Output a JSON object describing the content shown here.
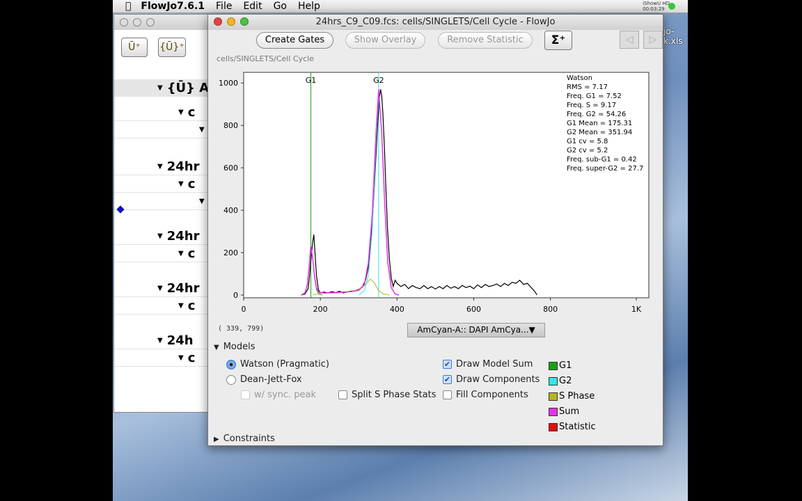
{
  "menubar": {
    "app": "FlowJo7.6.1",
    "items": [
      "File",
      "Edit",
      "Go",
      "Help"
    ],
    "status_app": "iShowU HD",
    "status_time": "00:03:29"
  },
  "desktop": {
    "file_label": "jo-\nk.xls"
  },
  "workspace": {
    "rows": [
      {
        "label": "{Ū} All",
        "indent": 1
      },
      {
        "label": "c",
        "indent": 2
      },
      {
        "label": "",
        "indent": 3
      },
      {
        "label": "24hr",
        "indent": 1
      },
      {
        "label": "c",
        "indent": 2
      },
      {
        "label": "",
        "indent": 3
      },
      {
        "label": "24hr",
        "indent": 1
      },
      {
        "label": "c",
        "indent": 2
      },
      {
        "label": "24hr",
        "indent": 1
      },
      {
        "label": "c",
        "indent": 2
      },
      {
        "label": "24h",
        "indent": 1
      },
      {
        "label": "c",
        "indent": 2
      }
    ]
  },
  "window": {
    "title": "24hrs_C9_C09.fcs: cells/SINGLETS/Cell Cycle - FlowJo",
    "breadcrumb": "cells/SINGLETS/Cell Cycle",
    "buttons": {
      "create_gates": "Create Gates",
      "show_overlay": "Show Overlay",
      "remove_statistic": "Remove Statistic",
      "sigma": "Σ⁺",
      "prev": "◁",
      "next": "▷"
    },
    "coord_readout": "( 339, 799)",
    "parameter": "AmCyan-A:: DAPI AmCya...▼",
    "models_label": "Models",
    "constraints_label": "Constraints",
    "models": [
      {
        "label": "Watson (Pragmatic)",
        "selected": true
      },
      {
        "label": "Dean-Jett-Fox",
        "selected": false
      }
    ],
    "sync_peak": {
      "label": "w/ sync. peak",
      "checked": false,
      "disabled": true
    },
    "split_s": {
      "label": "Split S Phase Stats",
      "checked": false
    },
    "draw_model_sum": {
      "label": "Draw Model Sum",
      "checked": true
    },
    "draw_components": {
      "label": "Draw Components",
      "checked": true
    },
    "fill_components": {
      "label": "Fill Components",
      "checked": false
    },
    "legend": [
      {
        "label": "G1",
        "color": "#1aa01a"
      },
      {
        "label": "G2",
        "color": "#33e6e6"
      },
      {
        "label": "S Phase",
        "color": "#b5b520"
      },
      {
        "label": "Sum",
        "color": "#e633e6"
      },
      {
        "label": "Statistic",
        "color": "#e01010"
      }
    ]
  },
  "chart_data": {
    "type": "line",
    "xlim": [
      0,
      1024
    ],
    "ylim": [
      0,
      1050
    ],
    "xticks": [
      {
        "v": 0,
        "l": "0"
      },
      {
        "v": 200,
        "l": "200"
      },
      {
        "v": 400,
        "l": "400"
      },
      {
        "v": 600,
        "l": "600"
      },
      {
        "v": 800,
        "l": "800"
      },
      {
        "v": 1024,
        "l": "1K"
      }
    ],
    "yticks": [
      0,
      200,
      400,
      600,
      800,
      1000
    ],
    "gates": [
      {
        "label": "G1",
        "x": 175.31,
        "color": "#1aa01a"
      },
      {
        "label": "G2",
        "x": 351.94,
        "color": "#33e6e6"
      }
    ],
    "stats": [
      "Watson",
      "RMS  = 7.17",
      "Freq. G1  = 7.52",
      "Freq. S = 9.17",
      "Freq. G2  = 54.26",
      "G1 Mean  = 175.31",
      "G2 Mean  = 351.94",
      "G1 cv  = 5.8",
      "G2 cv = 5.2",
      "Freq. sub-G1  = 0.42",
      "Freq. super-G2 = 27.7"
    ],
    "histogram": [
      [
        150,
        0
      ],
      [
        160,
        5
      ],
      [
        168,
        30
      ],
      [
        172,
        90
      ],
      [
        176,
        180
      ],
      [
        180,
        250
      ],
      [
        183,
        285
      ],
      [
        186,
        200
      ],
      [
        190,
        90
      ],
      [
        195,
        25
      ],
      [
        200,
        10
      ],
      [
        210,
        14
      ],
      [
        220,
        10
      ],
      [
        230,
        16
      ],
      [
        240,
        12
      ],
      [
        250,
        18
      ],
      [
        260,
        10
      ],
      [
        270,
        15
      ],
      [
        280,
        18
      ],
      [
        290,
        20
      ],
      [
        300,
        25
      ],
      [
        310,
        40
      ],
      [
        318,
        70
      ],
      [
        325,
        130
      ],
      [
        332,
        250
      ],
      [
        338,
        420
      ],
      [
        344,
        620
      ],
      [
        350,
        820
      ],
      [
        354,
        930
      ],
      [
        357,
        970
      ],
      [
        360,
        940
      ],
      [
        363,
        860
      ],
      [
        367,
        700
      ],
      [
        371,
        500
      ],
      [
        375,
        320
      ],
      [
        380,
        170
      ],
      [
        385,
        80
      ],
      [
        390,
        40
      ],
      [
        395,
        70
      ],
      [
        400,
        55
      ],
      [
        410,
        40
      ],
      [
        420,
        50
      ],
      [
        430,
        30
      ],
      [
        440,
        45
      ],
      [
        450,
        35
      ],
      [
        460,
        30
      ],
      [
        470,
        45
      ],
      [
        480,
        30
      ],
      [
        490,
        40
      ],
      [
        500,
        28
      ],
      [
        510,
        40
      ],
      [
        520,
        30
      ],
      [
        530,
        45
      ],
      [
        540,
        32
      ],
      [
        550,
        40
      ],
      [
        560,
        30
      ],
      [
        570,
        45
      ],
      [
        580,
        35
      ],
      [
        590,
        42
      ],
      [
        600,
        30
      ],
      [
        610,
        48
      ],
      [
        620,
        35
      ],
      [
        630,
        50
      ],
      [
        640,
        40
      ],
      [
        650,
        45
      ],
      [
        660,
        52
      ],
      [
        670,
        40
      ],
      [
        680,
        55
      ],
      [
        690,
        45
      ],
      [
        700,
        60
      ],
      [
        710,
        55
      ],
      [
        720,
        70
      ],
      [
        730,
        50
      ],
      [
        740,
        55
      ],
      [
        750,
        35
      ],
      [
        760,
        15
      ],
      [
        765,
        0
      ]
    ],
    "g1_curve": [
      [
        150,
        0
      ],
      [
        160,
        10
      ],
      [
        166,
        50
      ],
      [
        170,
        120
      ],
      [
        175,
        230
      ],
      [
        180,
        170
      ],
      [
        185,
        80
      ],
      [
        190,
        25
      ],
      [
        196,
        5
      ],
      [
        205,
        0
      ]
    ],
    "g2_curve": [
      [
        300,
        0
      ],
      [
        315,
        20
      ],
      [
        325,
        90
      ],
      [
        335,
        300
      ],
      [
        345,
        700
      ],
      [
        352,
        950
      ],
      [
        360,
        760
      ],
      [
        368,
        420
      ],
      [
        376,
        150
      ],
      [
        385,
        35
      ],
      [
        395,
        5
      ],
      [
        405,
        0
      ]
    ],
    "s_curve": [
      [
        180,
        0
      ],
      [
        200,
        8
      ],
      [
        240,
        10
      ],
      [
        280,
        15
      ],
      [
        310,
        35
      ],
      [
        330,
        75
      ],
      [
        340,
        60
      ],
      [
        352,
        20
      ],
      [
        365,
        5
      ],
      [
        380,
        0
      ]
    ],
    "sum_curve": [
      [
        150,
        0
      ],
      [
        160,
        10
      ],
      [
        166,
        50
      ],
      [
        170,
        120
      ],
      [
        175,
        230
      ],
      [
        180,
        175
      ],
      [
        185,
        88
      ],
      [
        190,
        33
      ],
      [
        196,
        13
      ],
      [
        210,
        10
      ],
      [
        240,
        12
      ],
      [
        280,
        16
      ],
      [
        300,
        22
      ],
      [
        315,
        50
      ],
      [
        325,
        150
      ],
      [
        335,
        370
      ],
      [
        345,
        760
      ],
      [
        352,
        970
      ],
      [
        360,
        770
      ],
      [
        368,
        425
      ],
      [
        376,
        152
      ],
      [
        385,
        35
      ],
      [
        395,
        5
      ],
      [
        405,
        0
      ]
    ]
  }
}
